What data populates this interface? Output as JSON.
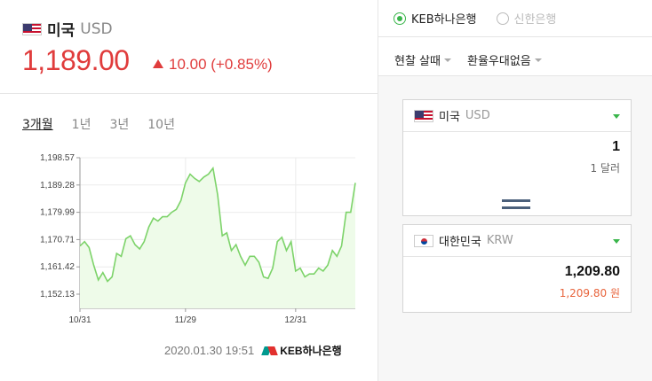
{
  "header": {
    "currency_name": "미국",
    "currency_code": "USD",
    "rate": "1,189.00",
    "change": "10.00 (+0.85%)"
  },
  "periods": [
    "3개월",
    "1년",
    "3년",
    "10년"
  ],
  "footer": {
    "timestamp": "2020.01.30 19:51",
    "bank_logo": "KEB하나은행"
  },
  "banks": [
    {
      "label": "KEB하나은행",
      "selected": true
    },
    {
      "label": "신한은행",
      "selected": false
    }
  ],
  "filters": {
    "rate_type": "현찰 살때",
    "preference": "환율우대없음"
  },
  "from": {
    "country": "미국",
    "code": "USD",
    "amount": "1",
    "amount_text": "1 달러"
  },
  "to": {
    "country": "대한민국",
    "code": "KRW",
    "amount": "1,209.80",
    "amount_text": "1,209.80 원"
  },
  "colors": {
    "up_red": "#e03c3c",
    "line_green": "#7dd36a",
    "fill_green": "#eefbe9",
    "accent_green": "#39b54a"
  },
  "chart_data": {
    "type": "area",
    "x_tick_labels": [
      "10/31",
      "11/29",
      "12/31"
    ],
    "y_tick_labels": [
      "1,198.57",
      "1,189.28",
      "1,179.99",
      "1,170.71",
      "1,161.42",
      "1,152.13"
    ],
    "ylim": [
      1152.13,
      1198.57
    ],
    "grid": true,
    "series": [
      {
        "values": [
          1168.5,
          1170.0,
          1168.0,
          1162.0,
          1157.0,
          1159.5,
          1156.5,
          1158.0,
          1166.0,
          1165.0,
          1171.0,
          1172.0,
          1169.0,
          1167.5,
          1170.0,
          1175.0,
          1178.0,
          1177.0,
          1178.5,
          1178.5,
          1180.0,
          1181.0,
          1184.0,
          1190.0,
          1193.0,
          1191.5,
          1190.5,
          1192.0,
          1193.0,
          1195.0,
          1186.0,
          1172.0,
          1173.0,
          1167.0,
          1169.0,
          1165.0,
          1162.0,
          1165.0,
          1165.0,
          1163.0,
          1158.0,
          1157.5,
          1161.0,
          1170.0,
          1171.5,
          1167.0,
          1170.0,
          1160.0,
          1161.0,
          1158.0,
          1159.0,
          1159.0,
          1161.0,
          1160.0,
          1162.0,
          1167.0,
          1165.0,
          1168.5,
          1180.0,
          1180.0,
          1190.0
        ]
      }
    ]
  }
}
